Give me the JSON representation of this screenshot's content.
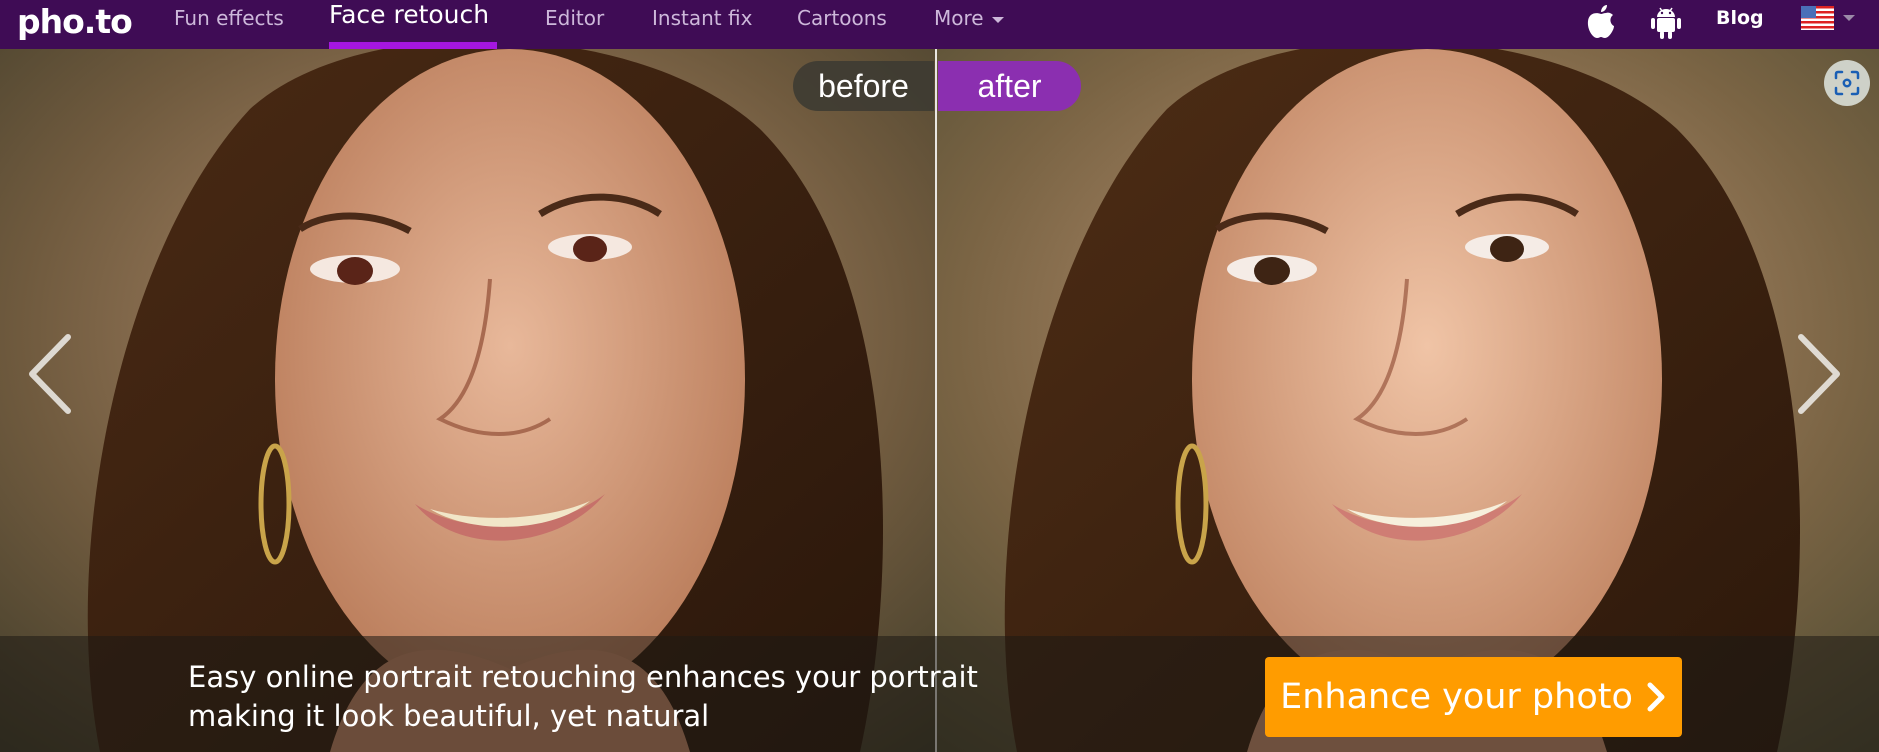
{
  "nav": {
    "logo": "pho.to",
    "items": [
      {
        "label": "Fun effects",
        "active": false
      },
      {
        "label": "Face retouch",
        "active": true
      },
      {
        "label": "Editor",
        "active": false
      },
      {
        "label": "Instant fix",
        "active": false
      },
      {
        "label": "Cartoons",
        "active": false
      },
      {
        "label": "More",
        "active": false,
        "dropdown": true
      }
    ],
    "blog_label": "Blog",
    "icons": [
      "apple-icon",
      "android-icon",
      "us-flag-icon"
    ],
    "accent_color": "#a516e0",
    "background_color": "#3f0c55"
  },
  "comparison": {
    "before_label": "before",
    "after_label": "after",
    "before_color": "#3c3a32",
    "after_color": "#8b2fb0"
  },
  "caption": {
    "line1": "Easy online portrait retouching enhances your portrait",
    "line2": "making it look beautiful, yet natural"
  },
  "cta": {
    "label": "Enhance your photo",
    "color": "#ff9c00"
  }
}
